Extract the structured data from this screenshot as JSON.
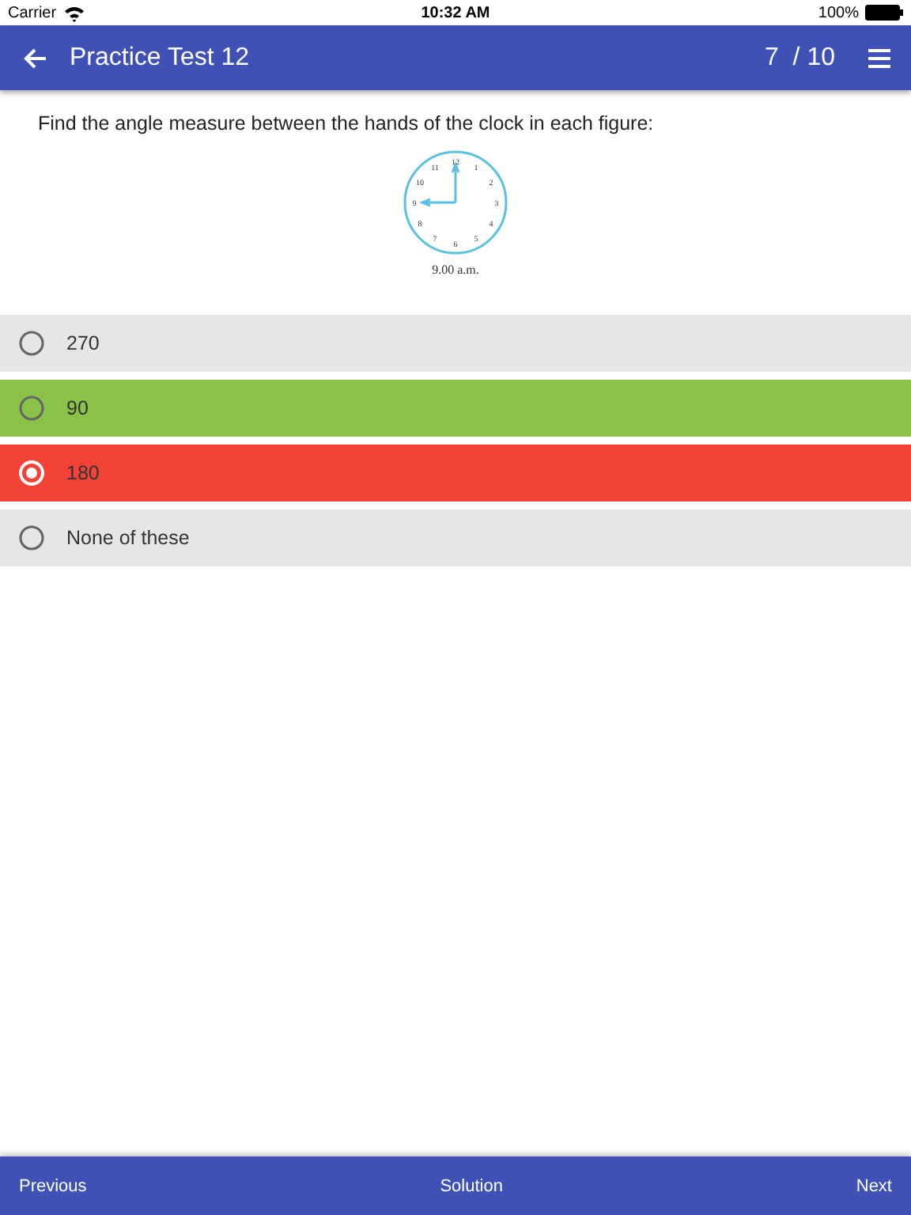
{
  "status_bar": {
    "carrier": "Carrier",
    "time": "10:32 AM",
    "battery": "100%"
  },
  "header": {
    "title": "Practice Test 12",
    "progress": "7  / 10"
  },
  "question": {
    "text": "Find the angle measure between the hands of the clock in each figure:",
    "clock": {
      "numerals": [
        "12",
        "1",
        "2",
        "3",
        "4",
        "5",
        "6",
        "7",
        "8",
        "9",
        "10",
        "11"
      ],
      "caption": "9.00 a.m."
    }
  },
  "options": [
    {
      "label": "270",
      "selected": false,
      "color": "#e6e6e6"
    },
    {
      "label": "90",
      "selected": false,
      "color": "#8bc34a"
    },
    {
      "label": "180",
      "selected": true,
      "color": "#f44336"
    },
    {
      "label": "None of these",
      "selected": false,
      "color": "#e6e6e6"
    }
  ],
  "footer": {
    "buttons": [
      "Previous",
      "Solution",
      "Next"
    ]
  }
}
